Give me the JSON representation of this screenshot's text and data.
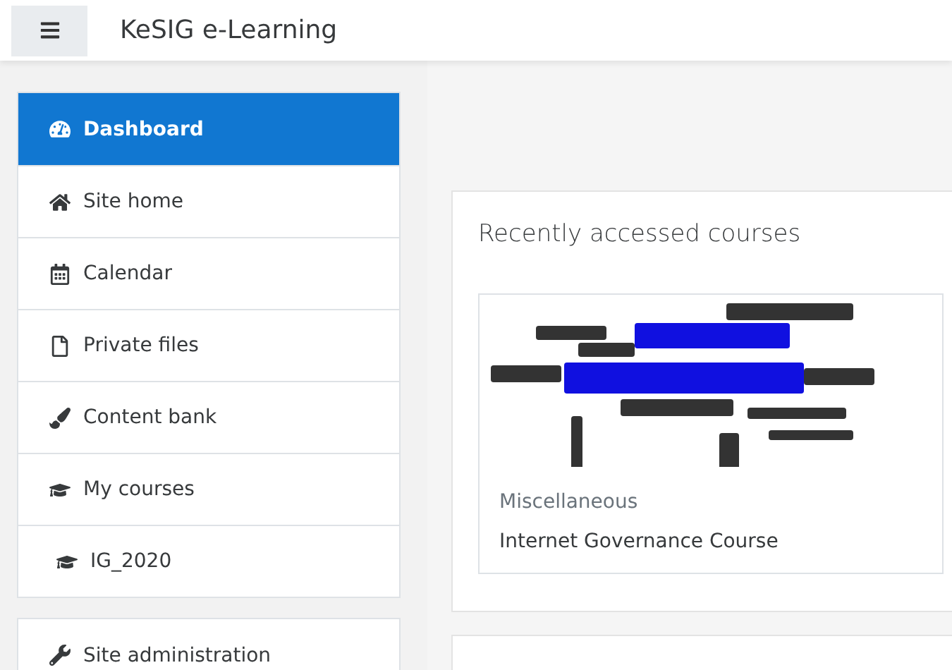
{
  "navbar": {
    "title": "KeSIG e-Learning"
  },
  "nav_groups": [
    {
      "items": [
        {
          "label": "Dashboard",
          "kind": "dashboard",
          "selected": true
        },
        {
          "label": "Site home",
          "kind": "home",
          "selected": false
        },
        {
          "label": "Calendar",
          "kind": "calendar",
          "selected": false
        },
        {
          "label": "Private files",
          "kind": "file",
          "selected": false
        },
        {
          "label": "Content bank",
          "kind": "brush",
          "selected": false
        },
        {
          "label": "My courses",
          "kind": "course",
          "selected": false,
          "children": [
            {
              "label": "IG_2020",
              "kind": "course",
              "selected": false
            }
          ]
        }
      ]
    },
    {
      "items": [
        {
          "label": "Site administration",
          "kind": "admin",
          "selected": false
        }
      ]
    }
  ],
  "recent": {
    "title": "Recently accessed courses",
    "courses": [
      {
        "category": "Miscellaneous",
        "name": "Internet Governance Course"
      }
    ]
  }
}
